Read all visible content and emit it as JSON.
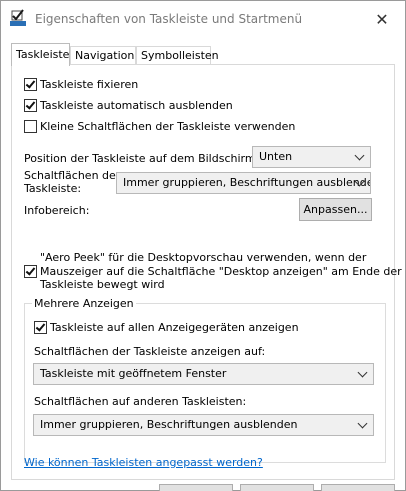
{
  "window": {
    "title": "Eigenschaften von Taskleiste und Startmenü",
    "close_glyph": "✕"
  },
  "tabs": [
    {
      "label": "Taskleiste",
      "active": true
    },
    {
      "label": "Navigation",
      "active": false
    },
    {
      "label": "Symbolleisten",
      "active": false
    }
  ],
  "taskbar": {
    "lock": {
      "label": "Taskleiste fixieren",
      "checked": true
    },
    "autohide": {
      "label": "Taskleiste automatisch ausblenden",
      "checked": true
    },
    "small_buttons": {
      "label": "Kleine Schaltflächen der Taskleiste verwenden",
      "checked": false
    },
    "position": {
      "label": "Position der Taskleiste auf dem Bildschirm:",
      "value": "Unten"
    },
    "buttons": {
      "label_line1": "Schaltflächen der",
      "label_line2": "Taskleiste:",
      "value": "Immer gruppieren, Beschriftungen ausblenden"
    },
    "notification": {
      "label": "Infobereich:",
      "button": "Anpassen..."
    },
    "aero_peek": {
      "line1": "\"Aero Peek\" für die Desktopvorschau verwenden, wenn der",
      "line2": "Mauszeiger auf die Schaltfläche \"Desktop anzeigen\" am Ende der",
      "line3": "Taskleiste bewegt wird",
      "checked": true
    }
  },
  "multi_display": {
    "title": "Mehrere Anzeigen",
    "show_all": {
      "label": "Taskleiste auf allen Anzeigegeräten anzeigen",
      "checked": true
    },
    "show_buttons_on": {
      "label": "Schaltflächen der Taskleiste anzeigen auf:",
      "value": "Taskleiste mit geöffnetem Fenster"
    },
    "other_buttons": {
      "label": "Schaltflächen auf anderen Taskleisten:",
      "value": "Immer gruppieren, Beschriftungen ausblenden"
    }
  },
  "help_link": "Wie können Taskleisten angepasst werden?",
  "colors": {
    "accent": "#0066cc",
    "title_text": "#7a7a7a"
  }
}
